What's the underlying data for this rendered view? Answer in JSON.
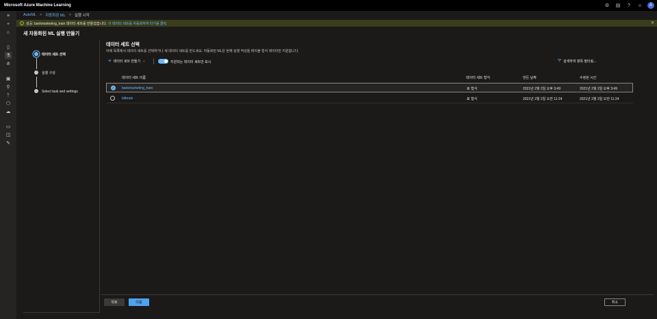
{
  "app": {
    "title": "Microsoft Azure Machine Learning",
    "avatar_initial": "A"
  },
  "breadcrumb": {
    "items": [
      "AutoML",
      "자동화된 ML",
      "실행 시작"
    ]
  },
  "notification": {
    "text": "성공: bankmarketing_train 데이터 세트를 만들었습니다.",
    "link": "이 데이터 세트를 자동화하여 타기를 클릭"
  },
  "page": {
    "title": "새 자동화된 ML 실행 만들기"
  },
  "steps": [
    {
      "label": "데이터 세트 선택"
    },
    {
      "label": "실행 구성"
    },
    {
      "label": "Select task and settings"
    }
  ],
  "section": {
    "title": "데이터 세트 선택",
    "description": "아래 목록에서 데이터 세트를 선택하거나 새 데이터 세트를 만드세요. 자동화된 ML은 현재 실행 작성을 테이블 형식 데이터만 지원합니다."
  },
  "toolbar": {
    "create_label": "데이터 세트 만들기",
    "toggle_label": "지원되는 데이터 세트만 표시",
    "toggle_on": true,
    "filter_label": "검색하여 항목 필터링..."
  },
  "table": {
    "columns": [
      "데이터 세트 이름",
      "데이터 세트 형식",
      "만든 날짜",
      "수정된 시간"
    ],
    "rows": [
      {
        "name": "bankmarketing_train",
        "type": "표 형식",
        "created": "2021년 2월 2일 오후 3:49",
        "modified": "2021년 2월 2일 오후 3:49",
        "selected": true
      },
      {
        "name": "bitbrain",
        "type": "표 형식",
        "created": "2021년 2월 2일 오전 11:24",
        "modified": "2021년 2월 2일 오전 11:24",
        "selected": false
      }
    ]
  },
  "footer": {
    "back_label": "뒤로",
    "next_label": "다음",
    "cancel_label": "취소"
  },
  "icons": {
    "top": [
      "settings-icon",
      "feedback-icon",
      "help-icon",
      "smiley-icon"
    ],
    "nav": [
      "hamburger-icon",
      "add-icon",
      "home-icon",
      "notebook-icon",
      "automl-icon",
      "designer-icon",
      "datasets-icon",
      "experiments-icon",
      "pipelines-icon",
      "models-icon",
      "endpoints-icon",
      "compute-icon",
      "datastores-icon",
      "labeling-icon"
    ]
  },
  "colors": {
    "accent": "#6cb8f6",
    "primary_button": "#4ea3ef",
    "notification_bg": "#393d1b",
    "success": "#8fc23f"
  }
}
